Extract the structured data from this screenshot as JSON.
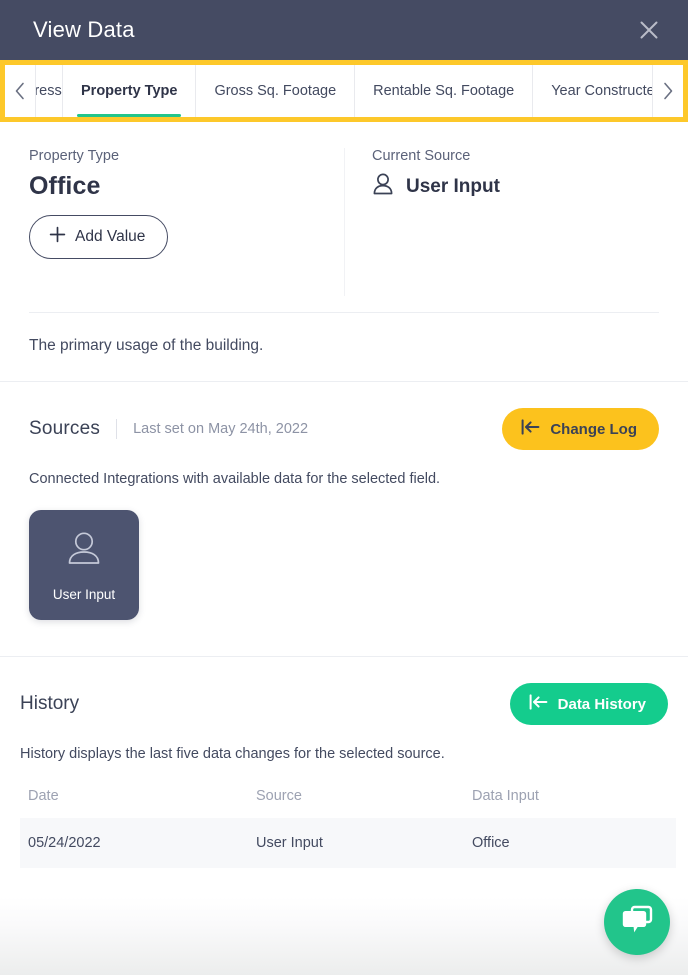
{
  "header": {
    "title": "View Data",
    "close_label": "Close"
  },
  "tabs": {
    "prev_label": "Previous tabs",
    "next_label": "Next tabs",
    "items": [
      {
        "label": "dress",
        "active": false
      },
      {
        "label": "Property Type",
        "active": true
      },
      {
        "label": "Gross Sq. Footage",
        "active": false
      },
      {
        "label": "Rentable Sq. Footage",
        "active": false
      },
      {
        "label": "Year Constructed",
        "active": false
      }
    ]
  },
  "field": {
    "label": "Property Type",
    "value": "Office",
    "add_value_label": "Add Value",
    "description": "The primary usage of the building."
  },
  "current_source": {
    "label": "Current Source",
    "value": "User Input"
  },
  "sources": {
    "title": "Sources",
    "last_set": "Last set on May 24th, 2022",
    "change_log_label": "Change Log",
    "description": "Connected Integrations with available data for the selected field.",
    "cards": [
      {
        "label": "User Input",
        "icon": "user-icon"
      }
    ]
  },
  "history": {
    "title": "History",
    "data_history_label": "Data History",
    "description": "History displays the last five data changes for the selected source.",
    "columns": [
      "Date",
      "Source",
      "Data Input"
    ],
    "rows": [
      {
        "date": "05/24/2022",
        "source": "User Input",
        "input": "Office"
      }
    ]
  },
  "chat": {
    "label": "Open chat"
  },
  "colors": {
    "header_bg": "#454b63",
    "tab_highlight": "#fdc82a",
    "active_tab_underline": "#22c58b",
    "change_log_bg": "#fcc21d",
    "data_history_bg": "#14cc8d",
    "source_card_bg": "#4d5470",
    "chat_bg": "#22c58b"
  }
}
